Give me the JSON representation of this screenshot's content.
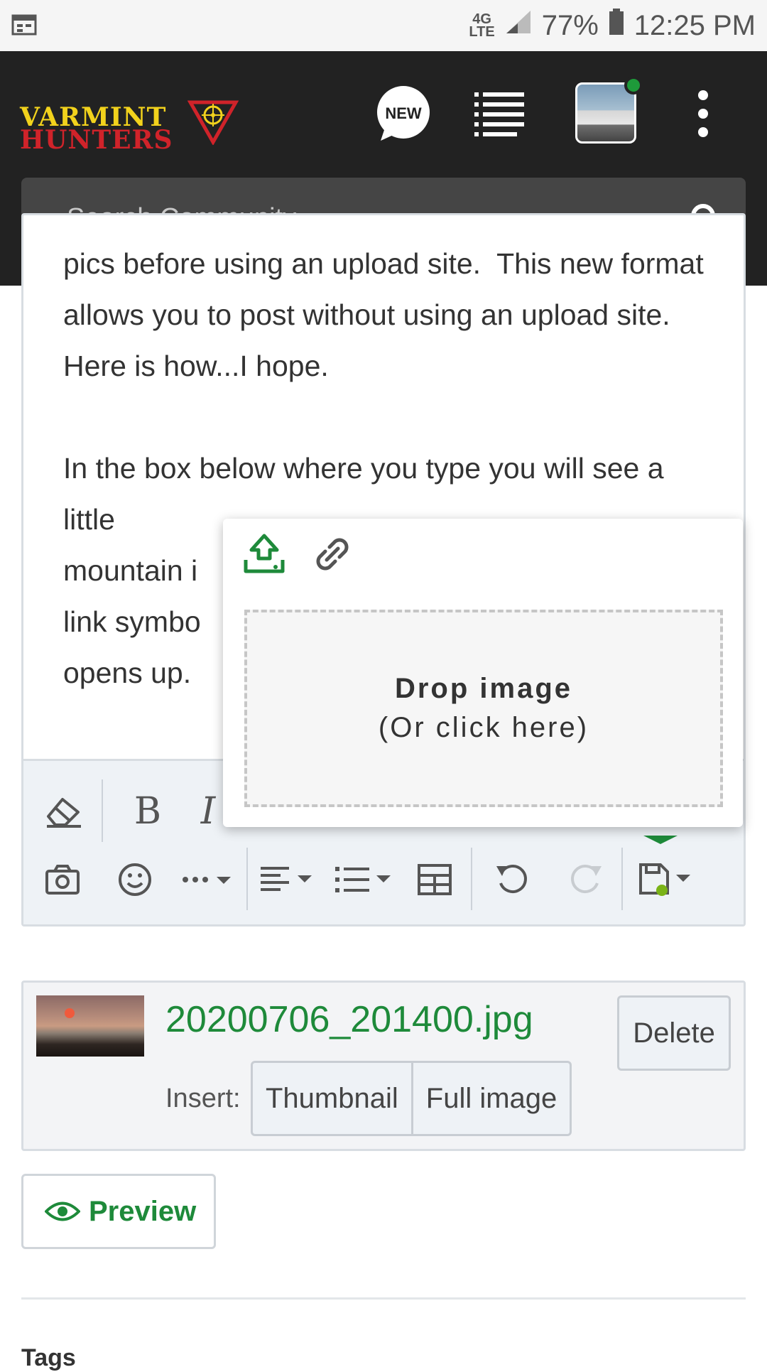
{
  "status_bar": {
    "network": "4G",
    "network_sub": "LTE",
    "battery": "77%",
    "time": "12:25 PM"
  },
  "header": {
    "logo_line1": "VARMINT",
    "logo_line2": "HUNTERS",
    "new_badge": "NEW",
    "search_placeholder": "Search Community",
    "colors": {
      "background": "#222222",
      "logo_yellow": "#f2d21c",
      "logo_red": "#d0232a",
      "online_dot": "#1e9a3a"
    }
  },
  "editor": {
    "paragraphs": [
      "pics before using an upload site.  This new format allows you to post without using an upload site.  Here is how...I hope.",
      "In the box below where you type you will see a little",
      "mountain i",
      "link symbo",
      "opens up."
    ],
    "toolbar": {
      "row1": [
        "eraser-icon",
        "bold-icon",
        "italic-icon"
      ],
      "row2": [
        "camera-icon",
        "smiley-icon",
        "more-icon",
        "align-icon",
        "list-icon",
        "table-icon",
        "undo-icon",
        "redo-icon",
        "save-draft-icon"
      ],
      "bold_label": "B",
      "italic_label": "I"
    }
  },
  "image_popup": {
    "tabs": [
      "upload-icon",
      "link-icon"
    ],
    "drop_title": "Drop image",
    "drop_sub": "(Or click here)"
  },
  "attachment": {
    "filename": "20200706_201400.jpg",
    "delete_label": "Delete",
    "insert_label": "Insert:",
    "insert_options": [
      "Thumbnail",
      "Full image"
    ],
    "accent": "#1e8a3a"
  },
  "preview_label": "Preview",
  "tags_label": "Tags"
}
